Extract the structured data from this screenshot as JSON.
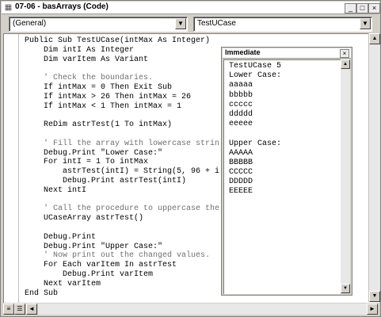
{
  "window": {
    "title": "07-06 - basArrays (Code)",
    "icon": "code-window-icon",
    "minimize_glyph": "_",
    "maximize_glyph": "□",
    "close_glyph": "×"
  },
  "object_combo": {
    "value": "(General)",
    "arrow": "▼"
  },
  "procedure_combo": {
    "value": "TestUCase",
    "arrow": "▼"
  },
  "code": {
    "lines": [
      {
        "text": "Public Sub TestUCase(intMax As Integer)",
        "type": "code"
      },
      {
        "text": "    Dim intI As Integer",
        "type": "code"
      },
      {
        "text": "    Dim varItem As Variant",
        "type": "code"
      },
      {
        "text": "",
        "type": "code"
      },
      {
        "text": "    ' Check the boundaries.",
        "type": "comment"
      },
      {
        "text": "    If intMax = 0 Then Exit Sub",
        "type": "code"
      },
      {
        "text": "    If intMax > 26 Then intMax = 26",
        "type": "code"
      },
      {
        "text": "    If intMax < 1 Then intMax = 1",
        "type": "code"
      },
      {
        "text": "",
        "type": "code"
      },
      {
        "text": "    ReDim astrTest(1 To intMax)",
        "type": "code"
      },
      {
        "text": "",
        "type": "code"
      },
      {
        "text": "    ' Fill the array with lowercase strin",
        "type": "comment"
      },
      {
        "text": "    Debug.Print \"Lower Case:\"",
        "type": "code"
      },
      {
        "text": "    For intI = 1 To intMax",
        "type": "code"
      },
      {
        "text": "        astrTest(intI) = String(5, 96 + i",
        "type": "code"
      },
      {
        "text": "        Debug.Print astrTest(intI)",
        "type": "code"
      },
      {
        "text": "    Next intI",
        "type": "code"
      },
      {
        "text": "",
        "type": "code"
      },
      {
        "text": "    ' Call the procedure to uppercase the",
        "type": "comment"
      },
      {
        "text": "    UCaseArray astrTest()",
        "type": "code"
      },
      {
        "text": "",
        "type": "code"
      },
      {
        "text": "    Debug.Print",
        "type": "code"
      },
      {
        "text": "    Debug.Print \"Upper Case:\"",
        "type": "code"
      },
      {
        "text": "    ' Now print out the changed values.",
        "type": "comment"
      },
      {
        "text": "    For Each varItem In astrTest",
        "type": "code"
      },
      {
        "text": "        Debug.Print varItem",
        "type": "code"
      },
      {
        "text": "    Next varItem",
        "type": "code"
      },
      {
        "text": "End Sub",
        "type": "code"
      }
    ]
  },
  "immediate": {
    "title": "Immediate",
    "close_glyph": "×",
    "lines": [
      "TestUCase 5",
      "Lower Case:",
      "aaaaa",
      "bbbbb",
      "ccccc",
      "ddddd",
      "eeeee",
      "",
      "Upper Case:",
      "AAAAA",
      "BBBBB",
      "CCCCC",
      "DDDDD",
      "EEEEE"
    ]
  },
  "scroll": {
    "up": "▲",
    "down": "▼",
    "left": "◄",
    "right": "►"
  },
  "view_buttons": {
    "procedure_view": "≡",
    "full_module_view": "☰"
  }
}
